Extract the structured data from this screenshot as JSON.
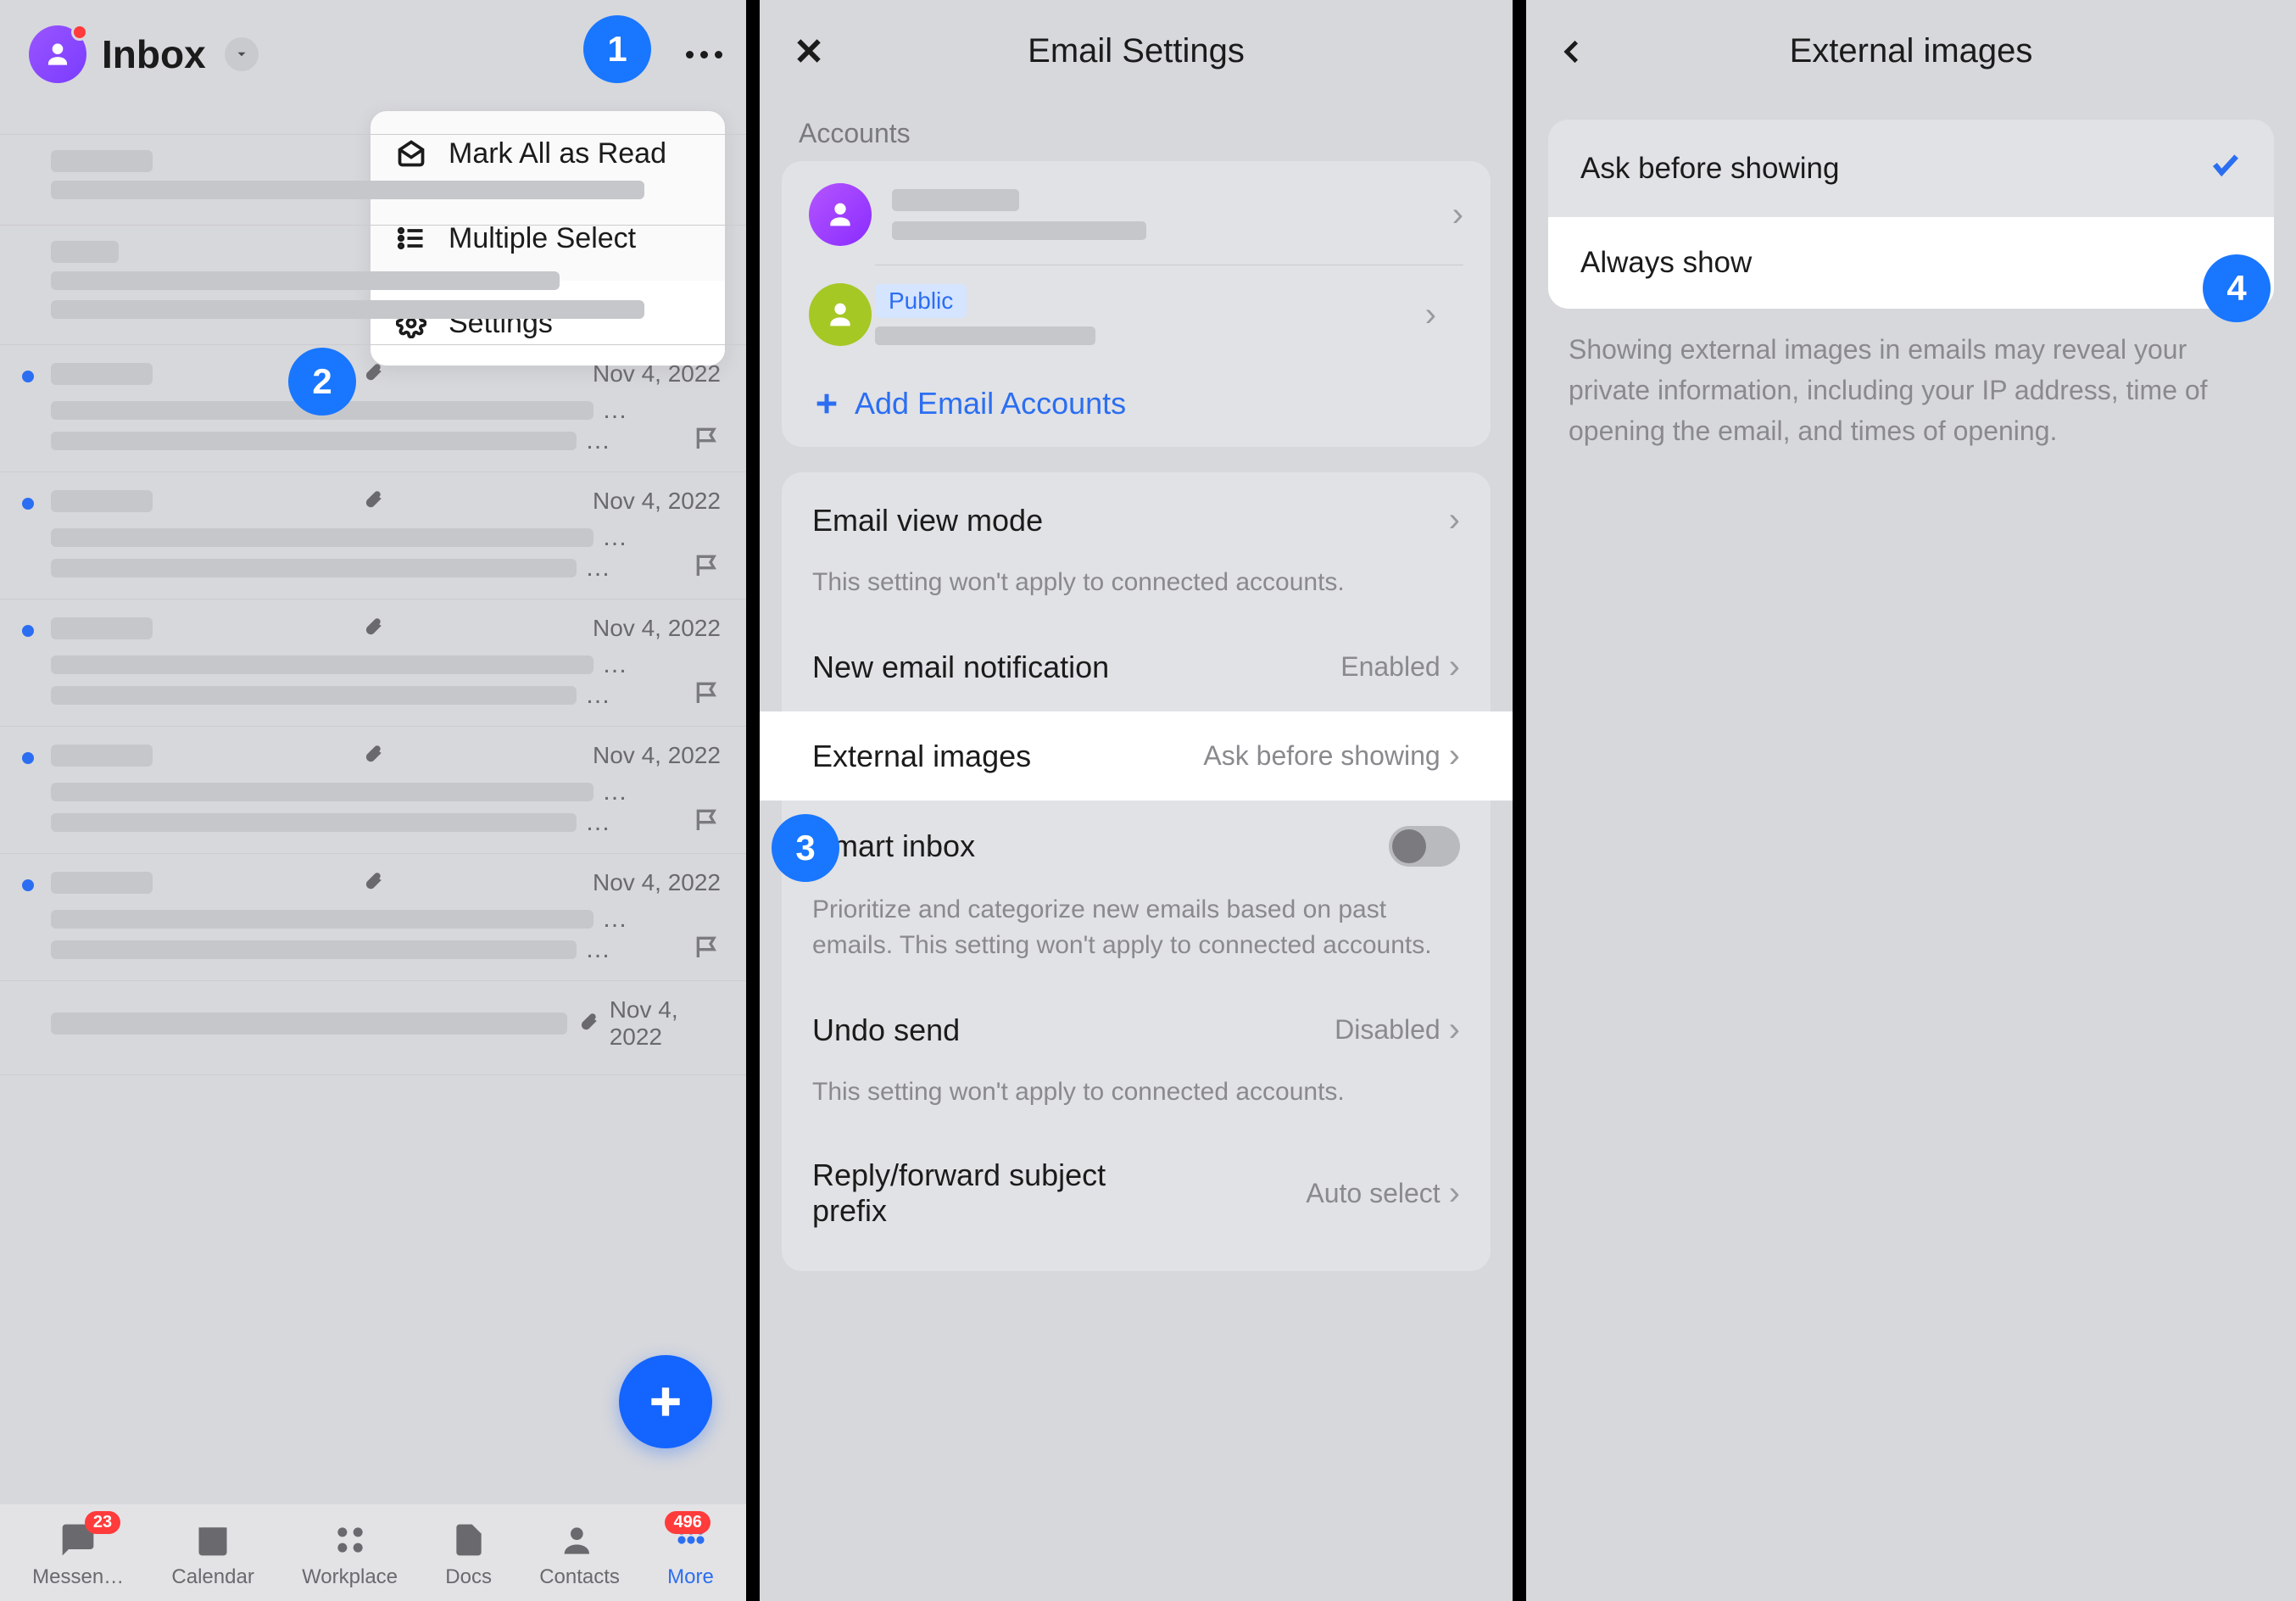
{
  "panel1": {
    "title": "Inbox",
    "dropdown": {
      "mark_read": "Mark All as Read",
      "multi_select": "Multiple Select",
      "settings": "Settings"
    },
    "date": "Nov 4, 2022",
    "nav": {
      "messenger": "Messen…",
      "calendar": "Calendar",
      "workplace": "Workplace",
      "docs": "Docs",
      "contacts": "Contacts",
      "more": "More",
      "badge_messenger": "23",
      "badge_more": "496"
    }
  },
  "panel2": {
    "title": "Email Settings",
    "accounts_label": "Accounts",
    "public_badge": "Public",
    "add_accounts": "Add Email Accounts",
    "view_mode": {
      "label": "Email view mode",
      "sub": "This setting won't apply to connected accounts."
    },
    "notif": {
      "label": "New email notification",
      "value": "Enabled"
    },
    "ext_img": {
      "label": "External images",
      "value": "Ask before showing"
    },
    "smart": {
      "label": "Smart inbox",
      "sub": "Prioritize and categorize new emails based on past emails. This setting won't apply to connected accounts."
    },
    "undo": {
      "label": "Undo send",
      "value": "Disabled",
      "sub": "This setting won't apply to connected accounts."
    },
    "prefix": {
      "label": "Reply/forward subject prefix",
      "value": "Auto select"
    }
  },
  "panel3": {
    "title": "External images",
    "opt_ask": "Ask before showing",
    "opt_always": "Always show",
    "note": "Showing external images in emails may reveal your private information, including your IP address, time of opening the email, and times of opening."
  },
  "steps": {
    "s1": "1",
    "s2": "2",
    "s3": "3",
    "s4": "4"
  }
}
